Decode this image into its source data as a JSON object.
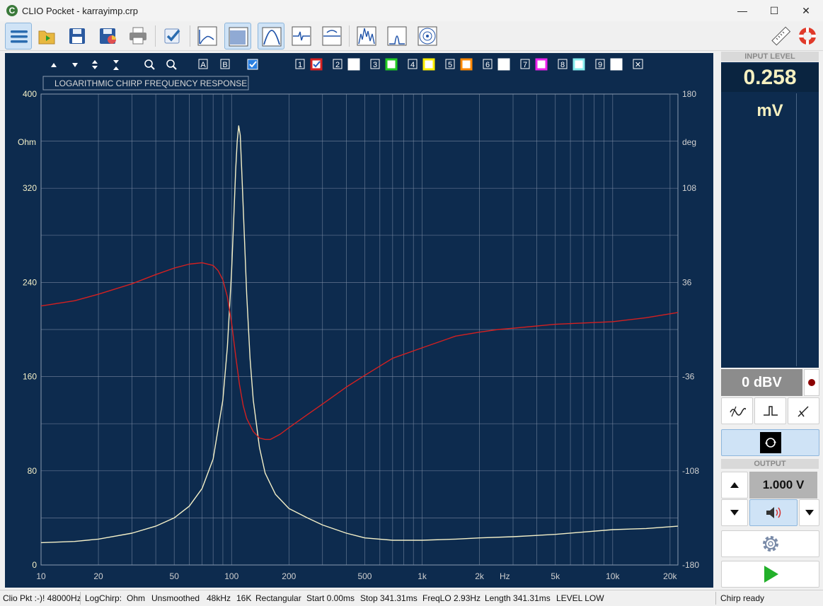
{
  "window": {
    "title": "CLIO Pocket - karrayimp.crp",
    "logo_letter": "C",
    "minimize": "—",
    "maximize": "☐",
    "close": "✕"
  },
  "plot": {
    "graph_toolbar": {
      "cursor_a": "A",
      "cursor_b": "B",
      "overlay_numbers": [
        "1",
        "2",
        "3",
        "4",
        "5",
        "6",
        "7",
        "8",
        "9"
      ],
      "overlay_colors": [
        "#d62020",
        "#ffffff",
        "#22cc22",
        "#ffee00",
        "#ff8800",
        "#ffffff",
        "#ee22ee",
        "#88eeee",
        "#ffffff"
      ],
      "clear": "✕"
    },
    "title_box": "LOGARITHMIC CHIRP FREQUENCY RESPONSE"
  },
  "chart_data": {
    "type": "line",
    "title": "LOGARITHMIC CHIRP FREQUENCY RESPONSE",
    "xlabel": "Hz",
    "ylabel": "Ohm",
    "ylabel_right": "deg",
    "xscale": "log",
    "xlim": [
      10,
      22000
    ],
    "ylim": [
      0,
      400
    ],
    "ylim_right": [
      -180,
      180
    ],
    "x_ticks": [
      "10",
      "20",
      "50",
      "100",
      "200",
      "500",
      "1k",
      "2k",
      "5k",
      "10k",
      "20k"
    ],
    "y_ticks": [
      "0",
      "80",
      "160",
      "240",
      "320",
      "400"
    ],
    "y_ticks_right": [
      "-180",
      "-108",
      "-36",
      "36",
      "108",
      "180"
    ],
    "grid": true,
    "series": [
      {
        "axis": "left",
        "color": "#f4f0c8",
        "x": [
          10,
          15,
          20,
          30,
          40,
          50,
          60,
          70,
          80,
          90,
          95,
          100,
          103,
          105,
          107,
          109,
          111,
          113,
          116,
          120,
          125,
          130,
          140,
          150,
          170,
          200,
          250,
          300,
          400,
          500,
          700,
          1000,
          1500,
          2000,
          3000,
          5000,
          7000,
          10000,
          15000,
          22000
        ],
        "y": [
          19,
          20,
          22,
          27,
          33,
          40,
          50,
          65,
          90,
          140,
          185,
          250,
          300,
          335,
          360,
          373,
          365,
          335,
          290,
          230,
          175,
          140,
          100,
          78,
          60,
          48,
          40,
          34,
          27,
          23,
          21,
          21,
          22,
          23,
          24,
          26,
          28,
          30,
          31,
          33
        ]
      },
      {
        "axis": "right",
        "color": "#d42020",
        "x": [
          10,
          15,
          20,
          30,
          40,
          50,
          60,
          70,
          80,
          85,
          90,
          95,
          100,
          105,
          110,
          115,
          120,
          130,
          140,
          150,
          160,
          180,
          200,
          250,
          300,
          400,
          500,
          700,
          1000,
          1500,
          2000,
          2500,
          3000,
          5000,
          7000,
          10000,
          15000,
          22000
        ],
        "y": [
          18,
          22,
          27,
          35,
          42,
          47,
          50,
          51,
          49,
          45,
          38,
          25,
          5,
          -20,
          -42,
          -58,
          -68,
          -78,
          -83,
          -84,
          -84,
          -80,
          -75,
          -65,
          -57,
          -44,
          -35,
          -22,
          -14,
          -5,
          -2,
          0,
          1,
          4,
          5,
          6,
          9,
          13
        ]
      }
    ]
  },
  "side": {
    "input_label": "INPUT LEVEL",
    "input_value": "0.258",
    "input_unit": "mV",
    "dbv": "0 dBV",
    "output_label": "OUTPUT",
    "output_value": "1.000 V"
  },
  "status": {
    "left": "Clio Pkt :-)! 48000Hz",
    "items": [
      "LogChirp:",
      "Ohm",
      "Unsmoothed",
      "48kHz",
      "16K",
      "Rectangular",
      "Start 0.00ms",
      "Stop 341.31ms",
      "FreqLO 2.93Hz",
      "Length 341.31ms",
      "LEVEL LOW"
    ],
    "right": "Chirp ready"
  }
}
